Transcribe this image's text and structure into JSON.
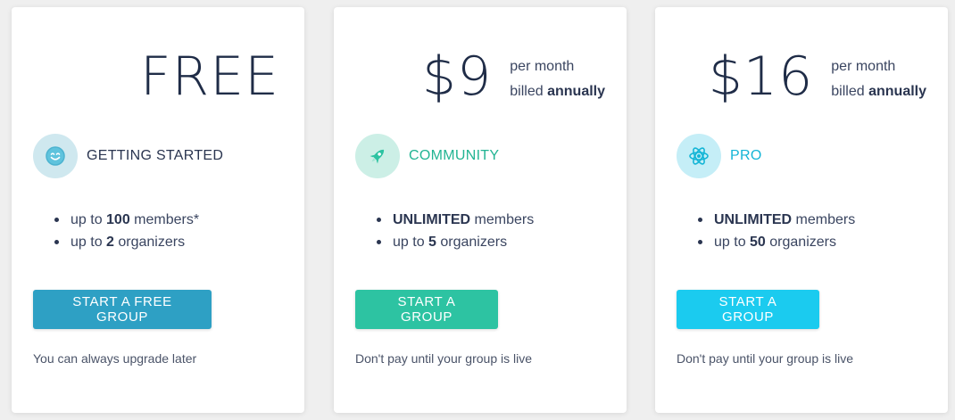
{
  "plans": [
    {
      "price": "FREE",
      "name": "GETTING STARTED",
      "icon": "smile-icon",
      "features": [
        {
          "pre": "up to ",
          "bold": "100",
          "post": " members*"
        },
        {
          "pre": "up to ",
          "bold": "2",
          "post": " organizers"
        }
      ],
      "cta": "START A FREE GROUP",
      "note": "You can always upgrade later",
      "accent": "#2ea0c4"
    },
    {
      "price": "$9",
      "meta_line1": "per month",
      "meta_line2_pre": "billed ",
      "meta_line2_bold": "annually",
      "name": "COMMUNITY",
      "icon": "rocket-icon",
      "features": [
        {
          "pre": "",
          "bold": "UNLIMITED",
          "post": " members"
        },
        {
          "pre": "up to ",
          "bold": "5",
          "post": " organizers"
        }
      ],
      "cta": "START A GROUP",
      "note": "Don't pay until your group is live",
      "accent": "#2dc3a2"
    },
    {
      "price": "$16",
      "meta_line1": "per month",
      "meta_line2_pre": "billed ",
      "meta_line2_bold": "annually",
      "name": "PRO",
      "icon": "atom-icon",
      "features": [
        {
          "pre": "",
          "bold": "UNLIMITED",
          "post": " members"
        },
        {
          "pre": "up to ",
          "bold": "50",
          "post": " organizers"
        }
      ],
      "cta": "START A GROUP",
      "note": "Don't pay until your group is live",
      "accent": "#1bcbef"
    }
  ]
}
